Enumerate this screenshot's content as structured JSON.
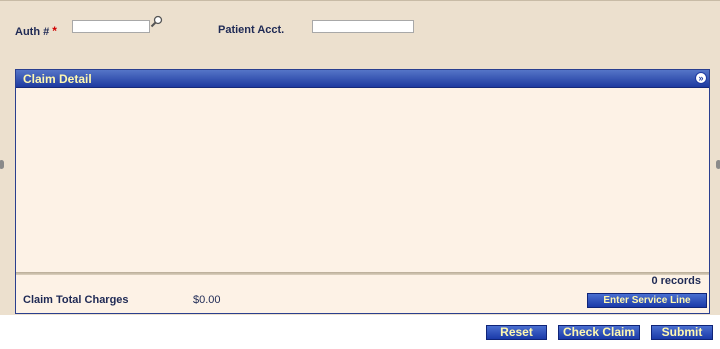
{
  "form": {
    "auth_label": "Auth #",
    "required_mark": "*",
    "auth_value": "",
    "patient_acct_label": "Patient Acct.",
    "patient_acct_value": ""
  },
  "claim_detail": {
    "title": "Claim Detail",
    "records_text": "0 records",
    "total_charges_label": "Claim Total Charges",
    "total_charges_value": "$0.00",
    "enter_service_line_label": "Enter Service Line"
  },
  "actions": {
    "reset_label": "Reset",
    "check_claim_label": "Check Claim",
    "submit_label": "Submit"
  },
  "colors": {
    "header_bg": "#1e3aa0",
    "header_text": "#fff8b0",
    "panel_bg": "#fdf2e6",
    "page_bg": "#ece0ce",
    "required": "#d00000"
  },
  "icons": {
    "lookup": "magnifier-icon",
    "collapse": "double-chevron-down-icon"
  }
}
